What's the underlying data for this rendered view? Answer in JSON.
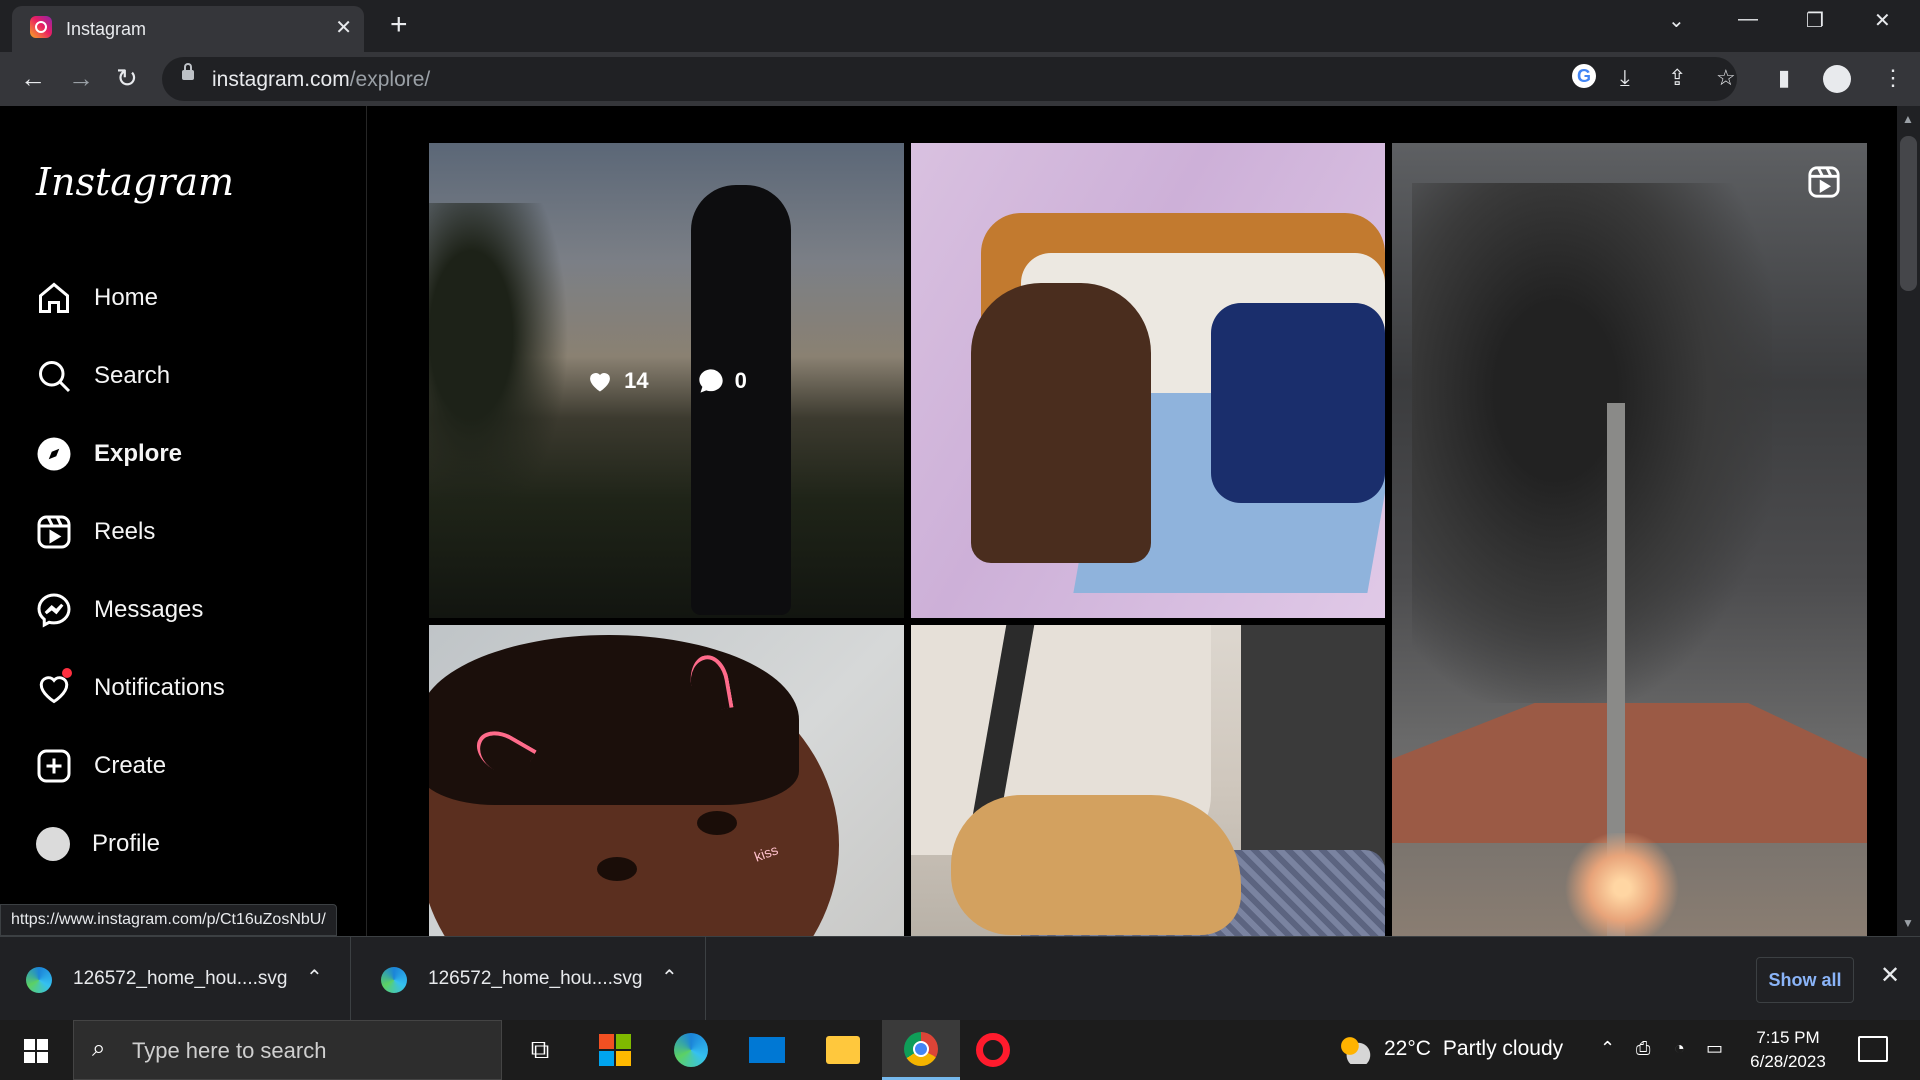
{
  "browser": {
    "tab_title": "Instagram",
    "tab_close": "✕",
    "new_tab": "+",
    "url_host": "instagram.com",
    "url_path": "/explore/",
    "status_url": "https://www.instagram.com/p/Ct16uZosNbU/"
  },
  "sidebar": {
    "logo": "Instagram",
    "items": [
      {
        "label": "Home",
        "icon": "home-icon"
      },
      {
        "label": "Search",
        "icon": "search-icon"
      },
      {
        "label": "Explore",
        "icon": "compass-icon",
        "active": true
      },
      {
        "label": "Reels",
        "icon": "reels-icon"
      },
      {
        "label": "Messages",
        "icon": "messenger-icon"
      },
      {
        "label": "Notifications",
        "icon": "heart-icon",
        "badge": true
      },
      {
        "label": "Create",
        "icon": "plus-square-icon"
      },
      {
        "label": "Profile",
        "icon": "profile-avatar"
      }
    ]
  },
  "explore": {
    "post1": {
      "likes": "14",
      "comments": "0"
    }
  },
  "downloads": {
    "items": [
      {
        "name": "126572_home_hou....svg"
      },
      {
        "name": "126572_home_hou....svg"
      }
    ],
    "show_all": "Show all",
    "close": "✕"
  },
  "taskbar": {
    "search_placeholder": "Type here to search",
    "weather_temp": "22°C",
    "weather_desc": "Partly cloudy",
    "time": "7:15 PM",
    "date": "6/28/2023"
  },
  "colors": {
    "accent_link": "#8ab4f8",
    "notification_dot": "#ff3040",
    "taskbar_active": "#76b9ed"
  }
}
